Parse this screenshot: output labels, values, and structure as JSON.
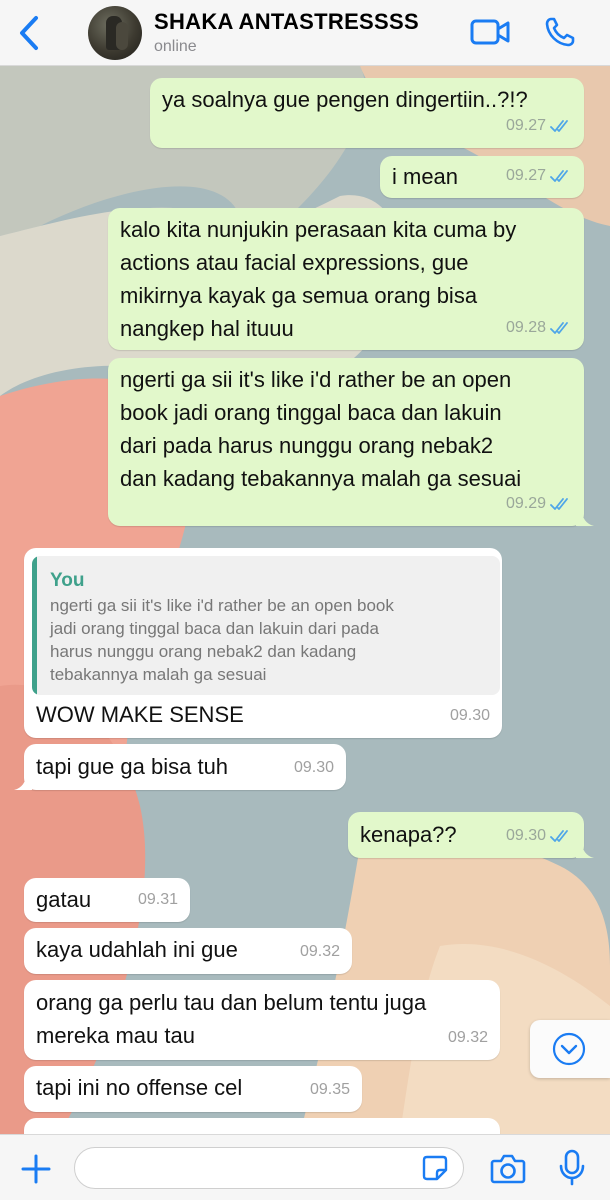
{
  "header": {
    "contact_name": "SHAKA ANTASTRESSSS",
    "status": "online",
    "accent": "#1a7cf3"
  },
  "messages": [
    {
      "direction": "out",
      "text": "ya soalnya gue pengen dingertiin..?!?",
      "time": "09.27",
      "read": true
    },
    {
      "direction": "out",
      "text": "i mean",
      "time": "09.27",
      "read": true
    },
    {
      "direction": "out",
      "text": "kalo kita nunjukin perasaan kita cuma by\nactions atau facial expressions, gue\nmikirnya kayak ga semua orang bisa\nnangkep hal ituuu",
      "time": "09.28",
      "read": true
    },
    {
      "direction": "out",
      "text": "ngerti ga sii it's like i'd rather be an open\nbook jadi orang tinggal baca dan lakuin\ndari pada harus nunggu orang nebak2\ndan kadang tebakannya malah ga sesuai",
      "time": "09.29",
      "read": true
    },
    {
      "direction": "in",
      "quote_author": "You",
      "quote_text": "ngerti ga sii it's like i'd rather be an open book\njadi orang tinggal baca dan lakuin dari pada\nharus nunggu orang nebak2 dan kadang\ntebakannya malah ga sesuai",
      "text": "WOW MAKE SENSE",
      "time": "09.30"
    },
    {
      "direction": "in",
      "text": "tapi gue ga bisa tuh",
      "time": "09.30"
    },
    {
      "direction": "out",
      "text": "kenapa??",
      "time": "09.30",
      "read": true
    },
    {
      "direction": "in",
      "text": "gatau",
      "time": "09.31"
    },
    {
      "direction": "in",
      "text": "kaya udahlah ini gue",
      "time": "09.32"
    },
    {
      "direction": "in",
      "text": "orang ga perlu tau dan belum tentu juga\nmereka mau tau",
      "time": "09.32"
    },
    {
      "direction": "in",
      "text": "tapi ini no offense cel",
      "time": "09.35"
    }
  ],
  "composer": {
    "value": "",
    "placeholder": ""
  },
  "icons": {
    "back": "chevron-left-icon",
    "video": "video-camera-icon",
    "call": "phone-icon",
    "scroll": "chevron-down-icon",
    "attach": "plus-icon",
    "sticker": "sticker-icon",
    "camera": "camera-icon",
    "mic": "microphone-icon"
  },
  "colors": {
    "outgoing_bubble": "#e2f8cb",
    "incoming_bubble": "#ffffff",
    "read_ticks": "#4fa6e8",
    "quote_accent": "#3fa18b"
  }
}
